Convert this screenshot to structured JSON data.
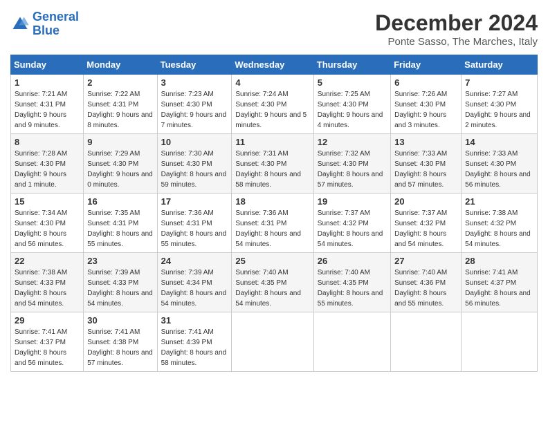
{
  "logo": {
    "line1": "General",
    "line2": "Blue"
  },
  "title": "December 2024",
  "location": "Ponte Sasso, The Marches, Italy",
  "days_of_week": [
    "Sunday",
    "Monday",
    "Tuesday",
    "Wednesday",
    "Thursday",
    "Friday",
    "Saturday"
  ],
  "weeks": [
    [
      {
        "day": "1",
        "sunrise": "7:21 AM",
        "sunset": "4:31 PM",
        "daylight": "9 hours and 9 minutes."
      },
      {
        "day": "2",
        "sunrise": "7:22 AM",
        "sunset": "4:31 PM",
        "daylight": "9 hours and 8 minutes."
      },
      {
        "day": "3",
        "sunrise": "7:23 AM",
        "sunset": "4:30 PM",
        "daylight": "9 hours and 7 minutes."
      },
      {
        "day": "4",
        "sunrise": "7:24 AM",
        "sunset": "4:30 PM",
        "daylight": "9 hours and 5 minutes."
      },
      {
        "day": "5",
        "sunrise": "7:25 AM",
        "sunset": "4:30 PM",
        "daylight": "9 hours and 4 minutes."
      },
      {
        "day": "6",
        "sunrise": "7:26 AM",
        "sunset": "4:30 PM",
        "daylight": "9 hours and 3 minutes."
      },
      {
        "day": "7",
        "sunrise": "7:27 AM",
        "sunset": "4:30 PM",
        "daylight": "9 hours and 2 minutes."
      }
    ],
    [
      {
        "day": "8",
        "sunrise": "7:28 AM",
        "sunset": "4:30 PM",
        "daylight": "9 hours and 1 minute."
      },
      {
        "day": "9",
        "sunrise": "7:29 AM",
        "sunset": "4:30 PM",
        "daylight": "9 hours and 0 minutes."
      },
      {
        "day": "10",
        "sunrise": "7:30 AM",
        "sunset": "4:30 PM",
        "daylight": "8 hours and 59 minutes."
      },
      {
        "day": "11",
        "sunrise": "7:31 AM",
        "sunset": "4:30 PM",
        "daylight": "8 hours and 58 minutes."
      },
      {
        "day": "12",
        "sunrise": "7:32 AM",
        "sunset": "4:30 PM",
        "daylight": "8 hours and 57 minutes."
      },
      {
        "day": "13",
        "sunrise": "7:33 AM",
        "sunset": "4:30 PM",
        "daylight": "8 hours and 57 minutes."
      },
      {
        "day": "14",
        "sunrise": "7:33 AM",
        "sunset": "4:30 PM",
        "daylight": "8 hours and 56 minutes."
      }
    ],
    [
      {
        "day": "15",
        "sunrise": "7:34 AM",
        "sunset": "4:30 PM",
        "daylight": "8 hours and 56 minutes."
      },
      {
        "day": "16",
        "sunrise": "7:35 AM",
        "sunset": "4:31 PM",
        "daylight": "8 hours and 55 minutes."
      },
      {
        "day": "17",
        "sunrise": "7:36 AM",
        "sunset": "4:31 PM",
        "daylight": "8 hours and 55 minutes."
      },
      {
        "day": "18",
        "sunrise": "7:36 AM",
        "sunset": "4:31 PM",
        "daylight": "8 hours and 54 minutes."
      },
      {
        "day": "19",
        "sunrise": "7:37 AM",
        "sunset": "4:32 PM",
        "daylight": "8 hours and 54 minutes."
      },
      {
        "day": "20",
        "sunrise": "7:37 AM",
        "sunset": "4:32 PM",
        "daylight": "8 hours and 54 minutes."
      },
      {
        "day": "21",
        "sunrise": "7:38 AM",
        "sunset": "4:32 PM",
        "daylight": "8 hours and 54 minutes."
      }
    ],
    [
      {
        "day": "22",
        "sunrise": "7:38 AM",
        "sunset": "4:33 PM",
        "daylight": "8 hours and 54 minutes."
      },
      {
        "day": "23",
        "sunrise": "7:39 AM",
        "sunset": "4:33 PM",
        "daylight": "8 hours and 54 minutes."
      },
      {
        "day": "24",
        "sunrise": "7:39 AM",
        "sunset": "4:34 PM",
        "daylight": "8 hours and 54 minutes."
      },
      {
        "day": "25",
        "sunrise": "7:40 AM",
        "sunset": "4:35 PM",
        "daylight": "8 hours and 54 minutes."
      },
      {
        "day": "26",
        "sunrise": "7:40 AM",
        "sunset": "4:35 PM",
        "daylight": "8 hours and 55 minutes."
      },
      {
        "day": "27",
        "sunrise": "7:40 AM",
        "sunset": "4:36 PM",
        "daylight": "8 hours and 55 minutes."
      },
      {
        "day": "28",
        "sunrise": "7:41 AM",
        "sunset": "4:37 PM",
        "daylight": "8 hours and 56 minutes."
      }
    ],
    [
      {
        "day": "29",
        "sunrise": "7:41 AM",
        "sunset": "4:37 PM",
        "daylight": "8 hours and 56 minutes."
      },
      {
        "day": "30",
        "sunrise": "7:41 AM",
        "sunset": "4:38 PM",
        "daylight": "8 hours and 57 minutes."
      },
      {
        "day": "31",
        "sunrise": "7:41 AM",
        "sunset": "4:39 PM",
        "daylight": "8 hours and 58 minutes."
      },
      null,
      null,
      null,
      null
    ]
  ]
}
